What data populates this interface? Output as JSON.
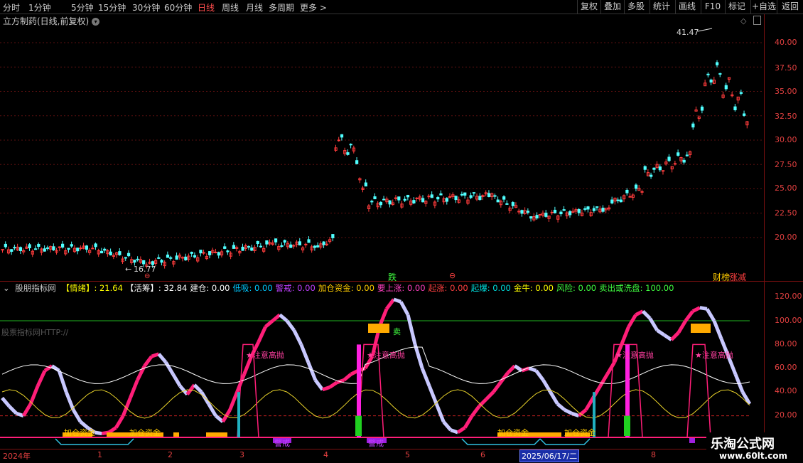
{
  "toolbar": {
    "timeframes": [
      "分时",
      "1分钟",
      "5分钟",
      "15分钟",
      "30分钟",
      "60分钟",
      "日线",
      "周线",
      "月线",
      "多周期",
      "更多 >"
    ],
    "active": "日线",
    "buttons": [
      "复权",
      "叠加",
      "多股",
      "统计",
      "画线",
      "F10",
      "标记",
      "+自选",
      "返回"
    ]
  },
  "main_pane": {
    "title": "立方制药(日线,前复权)",
    "high_label": "41.47",
    "low_label": "16.77",
    "price_axis": [
      "40.00",
      "37.50",
      "35.00",
      "32.50",
      "30.00",
      "27.50",
      "25.00",
      "22.50",
      "20.00"
    ],
    "markers": {
      "die": "跌",
      "jie1": "⊖",
      "jie2": "⊖",
      "sell_buy": "财榜",
      "zhangjian": "涨减"
    }
  },
  "indicator_pane": {
    "name": "股朋指标网",
    "fields": [
      {
        "label": "【情绪】:",
        "value": "21.64",
        "color": "#ffff00"
      },
      {
        "label": "【活筹】:",
        "value": "32.84",
        "color": "#ffffff"
      },
      {
        "label": "建仓:",
        "value": "0.00",
        "color": "#ffffff"
      },
      {
        "label": "低吸:",
        "value": "0.00",
        "color": "#00c8ff"
      },
      {
        "label": "警戒:",
        "value": "0.00",
        "color": "#c040ff"
      },
      {
        "label": "加仓资金:",
        "value": "0.00",
        "color": "#ffcc00"
      },
      {
        "label": "要上涨:",
        "value": "0.00",
        "color": "#ff40c0"
      },
      {
        "label": "起涨:",
        "value": "0.00",
        "color": "#ff4040"
      },
      {
        "label": "起爆:",
        "value": "0.00",
        "color": "#00e0e0"
      },
      {
        "label": "金牛:",
        "value": "0.00",
        "color": "#ffff00"
      },
      {
        "label": "风险:",
        "value": "0.00",
        "color": "#40ff40"
      },
      {
        "label": "卖出或洗盘:",
        "value": "100.00",
        "color": "#40ff40"
      }
    ],
    "axis": [
      "120.00",
      "100.00",
      "80.00",
      "60.00",
      "40.00",
      "20.00"
    ],
    "watermark_text": "股票指标网HTTP://",
    "annotations": {
      "high_sell": "★注意高抛",
      "add_capital": "加仓资金",
      "warning": "警戒",
      "sell": "卖"
    }
  },
  "date_axis": {
    "labels": [
      "2024年",
      "1",
      "2",
      "3",
      "4",
      "5",
      "6",
      "7",
      "8"
    ],
    "selected_date": "2025/06/17/二"
  },
  "site_watermark": {
    "name": "乐淘公式网",
    "url": "www.60lt.com"
  },
  "colors": {
    "up": "#ff3c3c",
    "down": "#50ffff",
    "axis": "#e24040",
    "k_line": "#ff1e78",
    "d_line": "#c8c8ff"
  }
}
